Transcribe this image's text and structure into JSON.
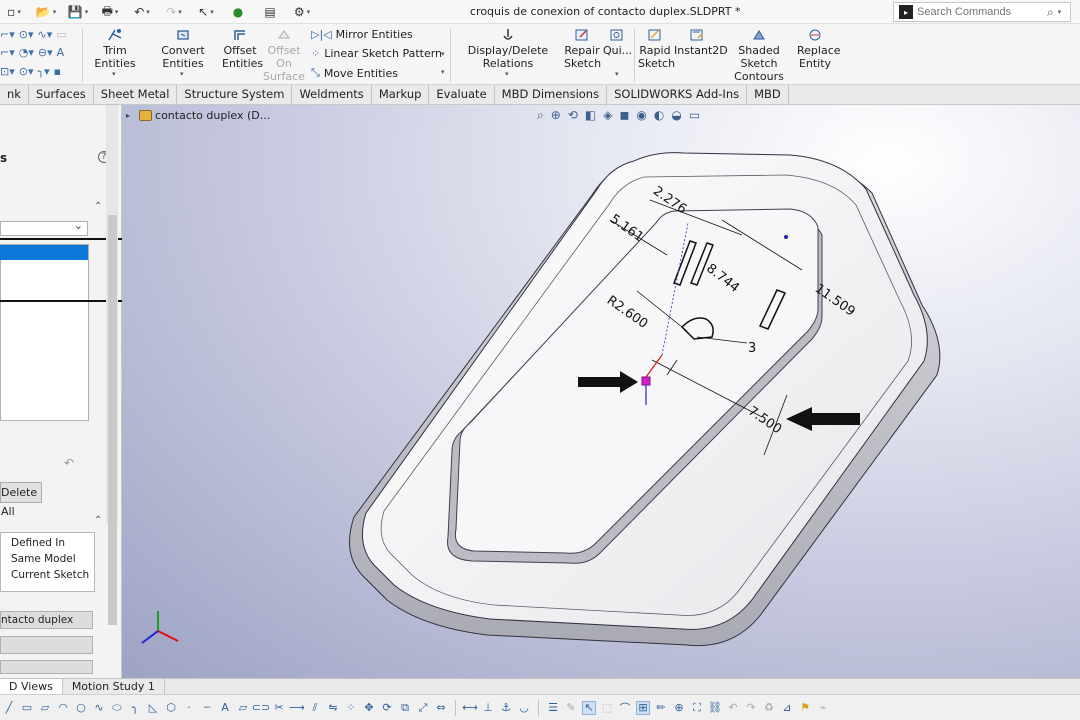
{
  "window": {
    "title": "croquis de conexion of contacto duplex.SLDPRT *",
    "search_placeholder": "Search Commands"
  },
  "quick_access": [
    "new-icon",
    "open-icon",
    "save-icon",
    "print-icon",
    "undo-icon",
    "redo-icon",
    "select-icon",
    "rebuild-icon",
    "file-properties-icon",
    "options-icon"
  ],
  "command_manager": {
    "trim_entities": "Trim Entities",
    "convert_entities": "Convert Entities",
    "offset_entities": [
      "Offset",
      "Entities"
    ],
    "offset_on_surface": [
      "Offset On",
      "Surface"
    ],
    "mirror_entities": "Mirror Entities",
    "linear_sketch_pattern": "Linear Sketch Pattern",
    "move_entities": "Move Entities",
    "display_delete_relations": "Display/Delete Relations",
    "repair_sketch": [
      "Repair",
      "Sketch"
    ],
    "quick_snaps": "Qui...",
    "rapid_sketch": [
      "Rapid",
      "Sketch"
    ],
    "instant2d": "Instant2D",
    "shaded_sketch_contours": [
      "Shaded Sketch",
      "Contours"
    ],
    "replace_entity": [
      "Replace",
      "Entity"
    ]
  },
  "tabs": [
    "nk",
    "Surfaces",
    "Sheet Metal",
    "Structure System",
    "Weldments",
    "Markup",
    "Evaluate",
    "MBD Dimensions",
    "SOLIDWORKS Add-Ins",
    "MBD"
  ],
  "property_manager": {
    "header_tail": "s",
    "delete_all": "Delete All",
    "relation_status": [
      "Defined In",
      "Same Model",
      "Current Sketch"
    ],
    "entity_field": "ntacto duplex",
    "help": "?"
  },
  "feature_tree": {
    "root": "contacto duplex  (D..."
  },
  "dimensions": {
    "d1": "2.276",
    "d2": "5.161",
    "d3": "8.744",
    "d4": "11.509",
    "d5": "R2.600",
    "d6": "3",
    "d7": "7.500"
  },
  "bottom_tabs": [
    "D Views",
    "Motion Study 1"
  ],
  "colors": {
    "viewport_bg": "#c4c7de",
    "selection_blue": "#0b78d7",
    "sketch_point": "#d11ed1",
    "icon_blue": "#2e5f9a"
  }
}
